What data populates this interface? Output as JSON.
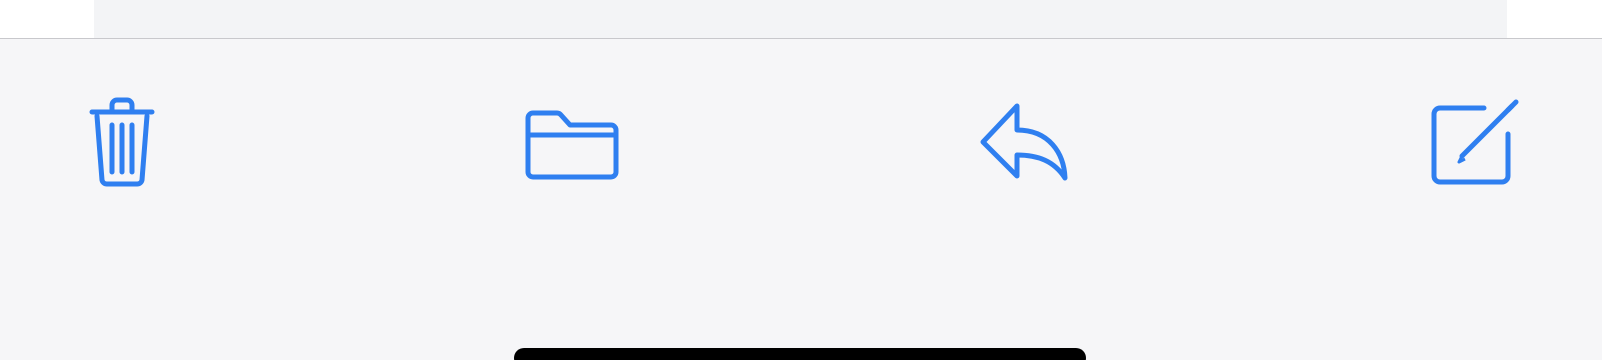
{
  "colors": {
    "accent": "#2f7ff0",
    "toolbar_background": "#f6f6f8",
    "content_card_background": "#f3f4f6",
    "divider": "#c8c8cc",
    "home_indicator": "#000000"
  },
  "toolbar": {
    "buttons": [
      {
        "id": "trash",
        "icon": "trash-icon"
      },
      {
        "id": "move-to-folder",
        "icon": "folder-icon"
      },
      {
        "id": "reply",
        "icon": "reply-icon"
      },
      {
        "id": "compose",
        "icon": "compose-icon"
      }
    ]
  }
}
